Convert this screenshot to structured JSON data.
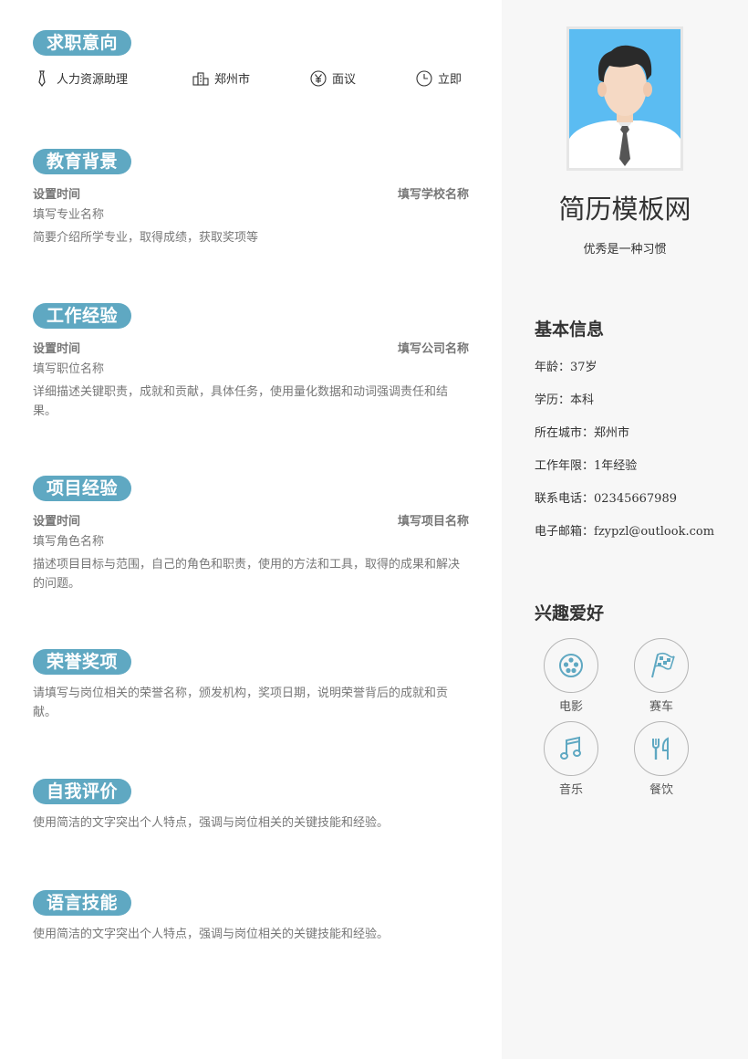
{
  "intent": {
    "title": "求职意向",
    "position": "人力资源助理",
    "city": "郑州市",
    "salary": "面议",
    "availability": "立即"
  },
  "education": {
    "title": "教育背景",
    "time": "设置时间",
    "school": "填写学校名称",
    "major": "填写专业名称",
    "desc": "简要介绍所学专业，取得成绩，获取奖项等"
  },
  "work": {
    "title": "工作经验",
    "time": "设置时间",
    "company": "填写公司名称",
    "role": "填写职位名称",
    "desc": "详细描述关键职责，成就和贡献，具体任务，使用量化数据和动词强调责任和结果。"
  },
  "project": {
    "title": "项目经验",
    "time": "设置时间",
    "name": "填写项目名称",
    "role": "填写角色名称",
    "desc": "描述项目目标与范围，自己的角色和职责，使用的方法和工具，取得的成果和解决的问题。"
  },
  "honors": {
    "title": "荣誉奖项",
    "desc": "请填写与岗位相关的荣誉名称，颁发机构，奖项日期，说明荣誉背后的成就和贡献。"
  },
  "self_eval": {
    "title": "自我评价",
    "desc": "使用简洁的文字突出个人特点，强调与岗位相关的关键技能和经验。"
  },
  "language": {
    "title": "语言技能",
    "desc": "使用简洁的文字突出个人特点，强调与岗位相关的关键技能和经验。"
  },
  "profile": {
    "name": "简历模板网",
    "motto": "优秀是一种习惯"
  },
  "basic": {
    "title": "基本信息",
    "age_label": "年龄：",
    "age": "37岁",
    "edu_label": "学历：",
    "edu": "本科",
    "city_label": "所在城市：",
    "city": "郑州市",
    "years_label": "工作年限：",
    "years": "1年经验",
    "phone_label": "联系电话：",
    "phone": "02345667989",
    "email_label": "电子邮箱：",
    "email": "fzypzl@outlook.com"
  },
  "hobbies": {
    "title": "兴趣爱好",
    "items": [
      {
        "label": "电影",
        "icon": "film-reel-icon"
      },
      {
        "label": "赛车",
        "icon": "checkered-flag-icon"
      },
      {
        "label": "音乐",
        "icon": "music-note-icon"
      },
      {
        "label": "餐饮",
        "icon": "fork-knife-icon"
      }
    ]
  },
  "colors": {
    "accent": "#5fa8c2",
    "sidebar_bg": "#f7f7f7",
    "photo_bg": "#5bbcf2"
  }
}
